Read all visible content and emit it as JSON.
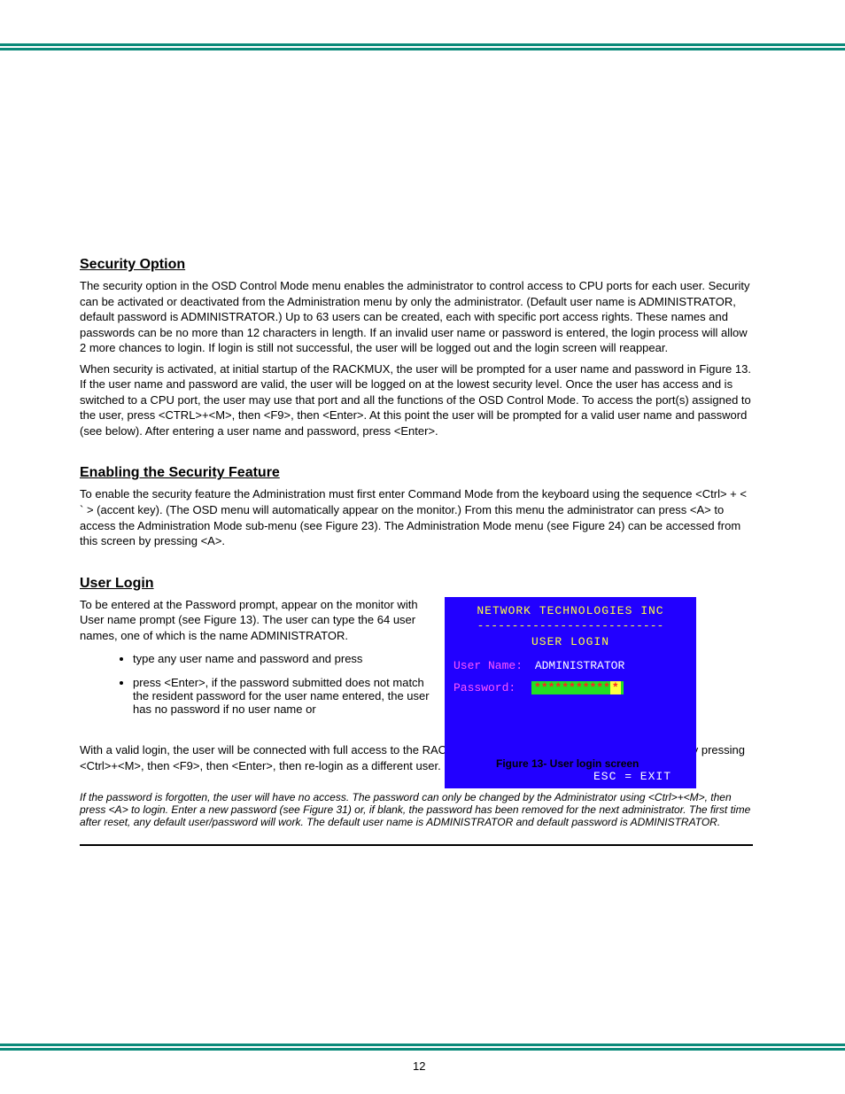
{
  "sections": {
    "security": {
      "heading": "Security Option",
      "p1": "The security option in the OSD Control Mode menu enables the administrator to control access to CPU ports for each user. Security can be activated or deactivated from the Administration menu by only the administrator. (Default user name is ADMINISTRATOR, default password is ADMINISTRATOR.) Up to 63 users can be created, each with specific port access rights. These names and passwords can be no more than 12 characters in length. If an invalid user name or password is entered, the login process will allow 2 more chances to login. If login is still not successful, the user will be logged out and the login screen will reappear.",
      "p2": "When security is activated, at initial startup of the RACKMUX, the user will be prompted for a user name and password in Figure 13. If the user name and password are valid, the user will be logged on at the lowest security level. Once the user has access and is switched to a CPU port, the user may use that port and all the functions of the OSD Control Mode. To access the port(s) assigned to the user, press <CTRL>+<M>, then <F9>, then <Enter>. At this point the user will be prompted for a valid user name and password (see below). After entering a user name and password, press <Enter>."
    },
    "enabling": {
      "heading": "Enabling the Security Feature",
      "p1": "To enable the security feature the Administration must first enter Command Mode from the keyboard using the sequence <Ctrl> + < ` > (accent key).  (The OSD menu will automatically appear on the monitor.)  From this menu the administrator can press <A> to access the Administration Mode sub-menu (see Figure 23). The Administration Mode menu (see Figure 24) can be accessed from this screen by pressing <A>."
    },
    "login": {
      "heading": "User Login",
      "p1": "To be entered at the Password prompt, appear on the monitor with User name prompt (see Figure 13). The user can type the 64 user names, one of which is the name ADMINISTRATOR.",
      "bullets": [
        "type any user name and password and press",
        "press <Enter>, if the password submitted does not match the resident password for the user name entered, the user has no password      if no user name or"
      ],
      "p2": "With a valid login, the user will be connected with full access to the RACKMUX. To login as a different user, log out first by pressing <Ctrl>+<M>, then <F9>, then <Enter>, then re-login as a different user."
    },
    "note": "If the password is forgotten, the user will have no access. The password can only be changed by the Administrator using <Ctrl>+<M>, then press <A> to login. Enter a new password (see Figure 31) or, if blank, the password has been removed for the next administrator. The first time after reset, any default user/password will work. The default user name is ADMINISTRATOR and default password is ADMINISTRATOR.",
    "figure_caption": "Figure 13- User login screen",
    "page_number": "12"
  },
  "osd": {
    "title": "NETWORK TECHNOLOGIES INC",
    "divider": "---------------------------",
    "subtitle": "USER LOGIN",
    "user_label": "User Name:",
    "user_value": "ADMINISTRATOR",
    "password_label": "Password:",
    "password_mask": "***********",
    "password_cursor": "*",
    "footer": "ESC = EXIT"
  }
}
